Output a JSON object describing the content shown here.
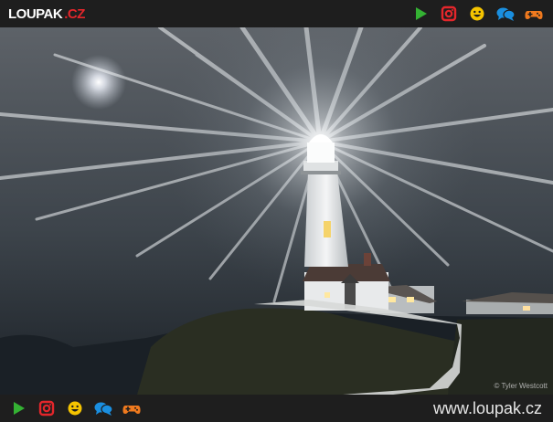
{
  "header": {
    "logo_main": "LOUPAK",
    "logo_tld": ".CZ"
  },
  "icons": [
    {
      "name": "play-icon",
      "color": "#34b233"
    },
    {
      "name": "instagram-icon",
      "color": "#e4262b"
    },
    {
      "name": "smiley-icon",
      "color": "#f5c400"
    },
    {
      "name": "chat-icon",
      "color": "#1a8fe0"
    },
    {
      "name": "gamepad-icon",
      "color": "#f07a1e"
    }
  ],
  "photo": {
    "credit": "© Tyler Westcott"
  },
  "footer": {
    "site_url": "www.loupak.cz"
  }
}
